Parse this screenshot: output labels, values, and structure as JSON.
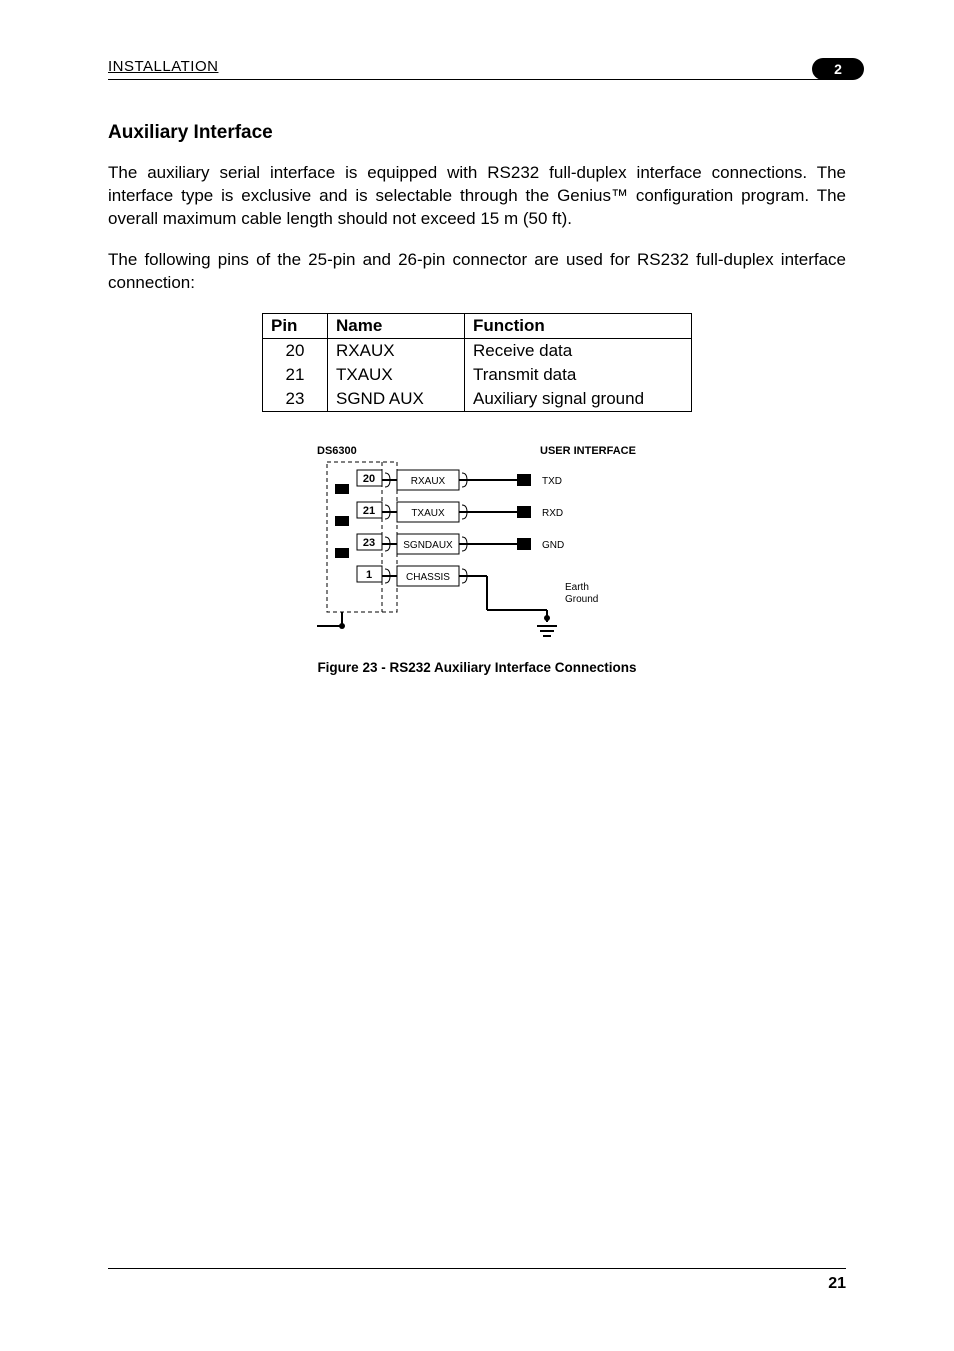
{
  "header": {
    "section": "INSTALLATION",
    "badge": "2"
  },
  "title": "Auxiliary Interface",
  "paragraphs": {
    "p1": "The auxiliary serial interface is equipped with RS232 full-duplex interface connections. The interface type is exclusive and is selectable through the Genius™ configuration program. The overall maximum cable length should not exceed 15 m (50 ft).",
    "p2": "The following pins of the 25-pin and 26-pin connector are used for RS232 full-duplex interface connection:"
  },
  "table": {
    "headers": {
      "pin": "Pin",
      "name": "Name",
      "func": "Function"
    },
    "rows": [
      {
        "pin": "20",
        "name": "RXAUX",
        "func": "Receive data"
      },
      {
        "pin": "21",
        "name": "TXAUX",
        "func": "Transmit data"
      },
      {
        "pin": "23",
        "name": "SGND AUX",
        "func": "Auxiliary signal ground"
      }
    ]
  },
  "diagram": {
    "left_title": "DS6300",
    "right_title": "USER INTERFACE",
    "pins": {
      "a": "20",
      "b": "21",
      "c": "23",
      "d": "1"
    },
    "signals": {
      "a": "RXAUX",
      "b": "TXAUX",
      "c": "SGNDAUX",
      "d": "CHASSIS"
    },
    "remote": {
      "a": "TXD",
      "b": "RXD",
      "c": "GND",
      "d1": "Earth",
      "d2": "Ground"
    }
  },
  "figure_caption": "Figure 23 - RS232 Auxiliary Interface Connections",
  "footer": {
    "page": "21"
  }
}
